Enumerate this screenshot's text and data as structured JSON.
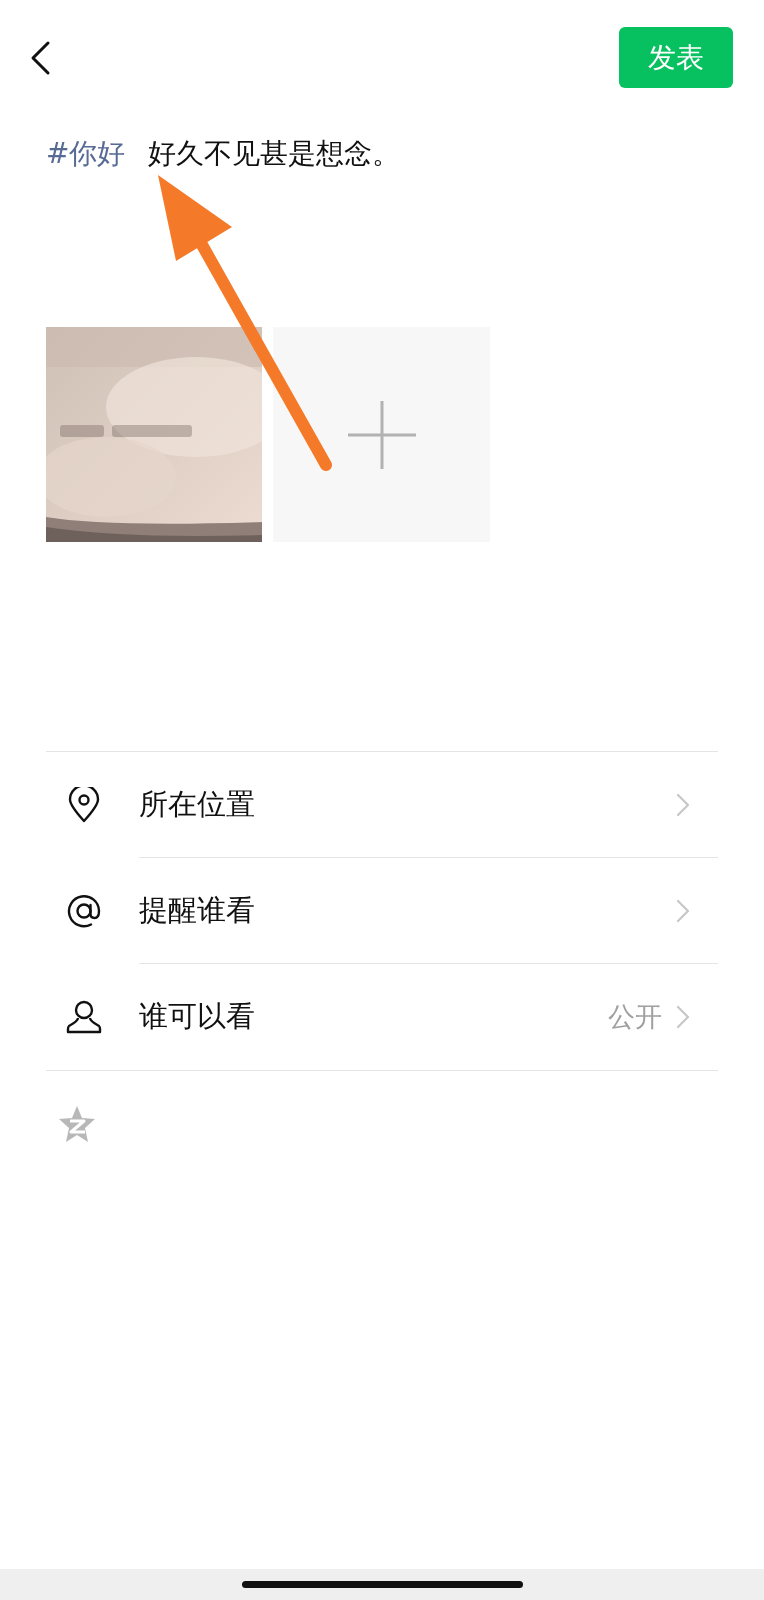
{
  "header": {
    "publish_button": "发表"
  },
  "post": {
    "hashtag": "#你好",
    "text": "好久不见甚是想念。"
  },
  "images": [
    {
      "kind": "picture"
    },
    {
      "kind": "add"
    }
  ],
  "options": [
    {
      "kind": "location",
      "label": "所在位置"
    },
    {
      "kind": "mention",
      "label": "提醒谁看"
    },
    {
      "kind": "visibility",
      "label": "谁可以看",
      "value": "公开"
    }
  ],
  "share_to": [
    {
      "kind": "qzone",
      "on": false
    }
  ]
}
